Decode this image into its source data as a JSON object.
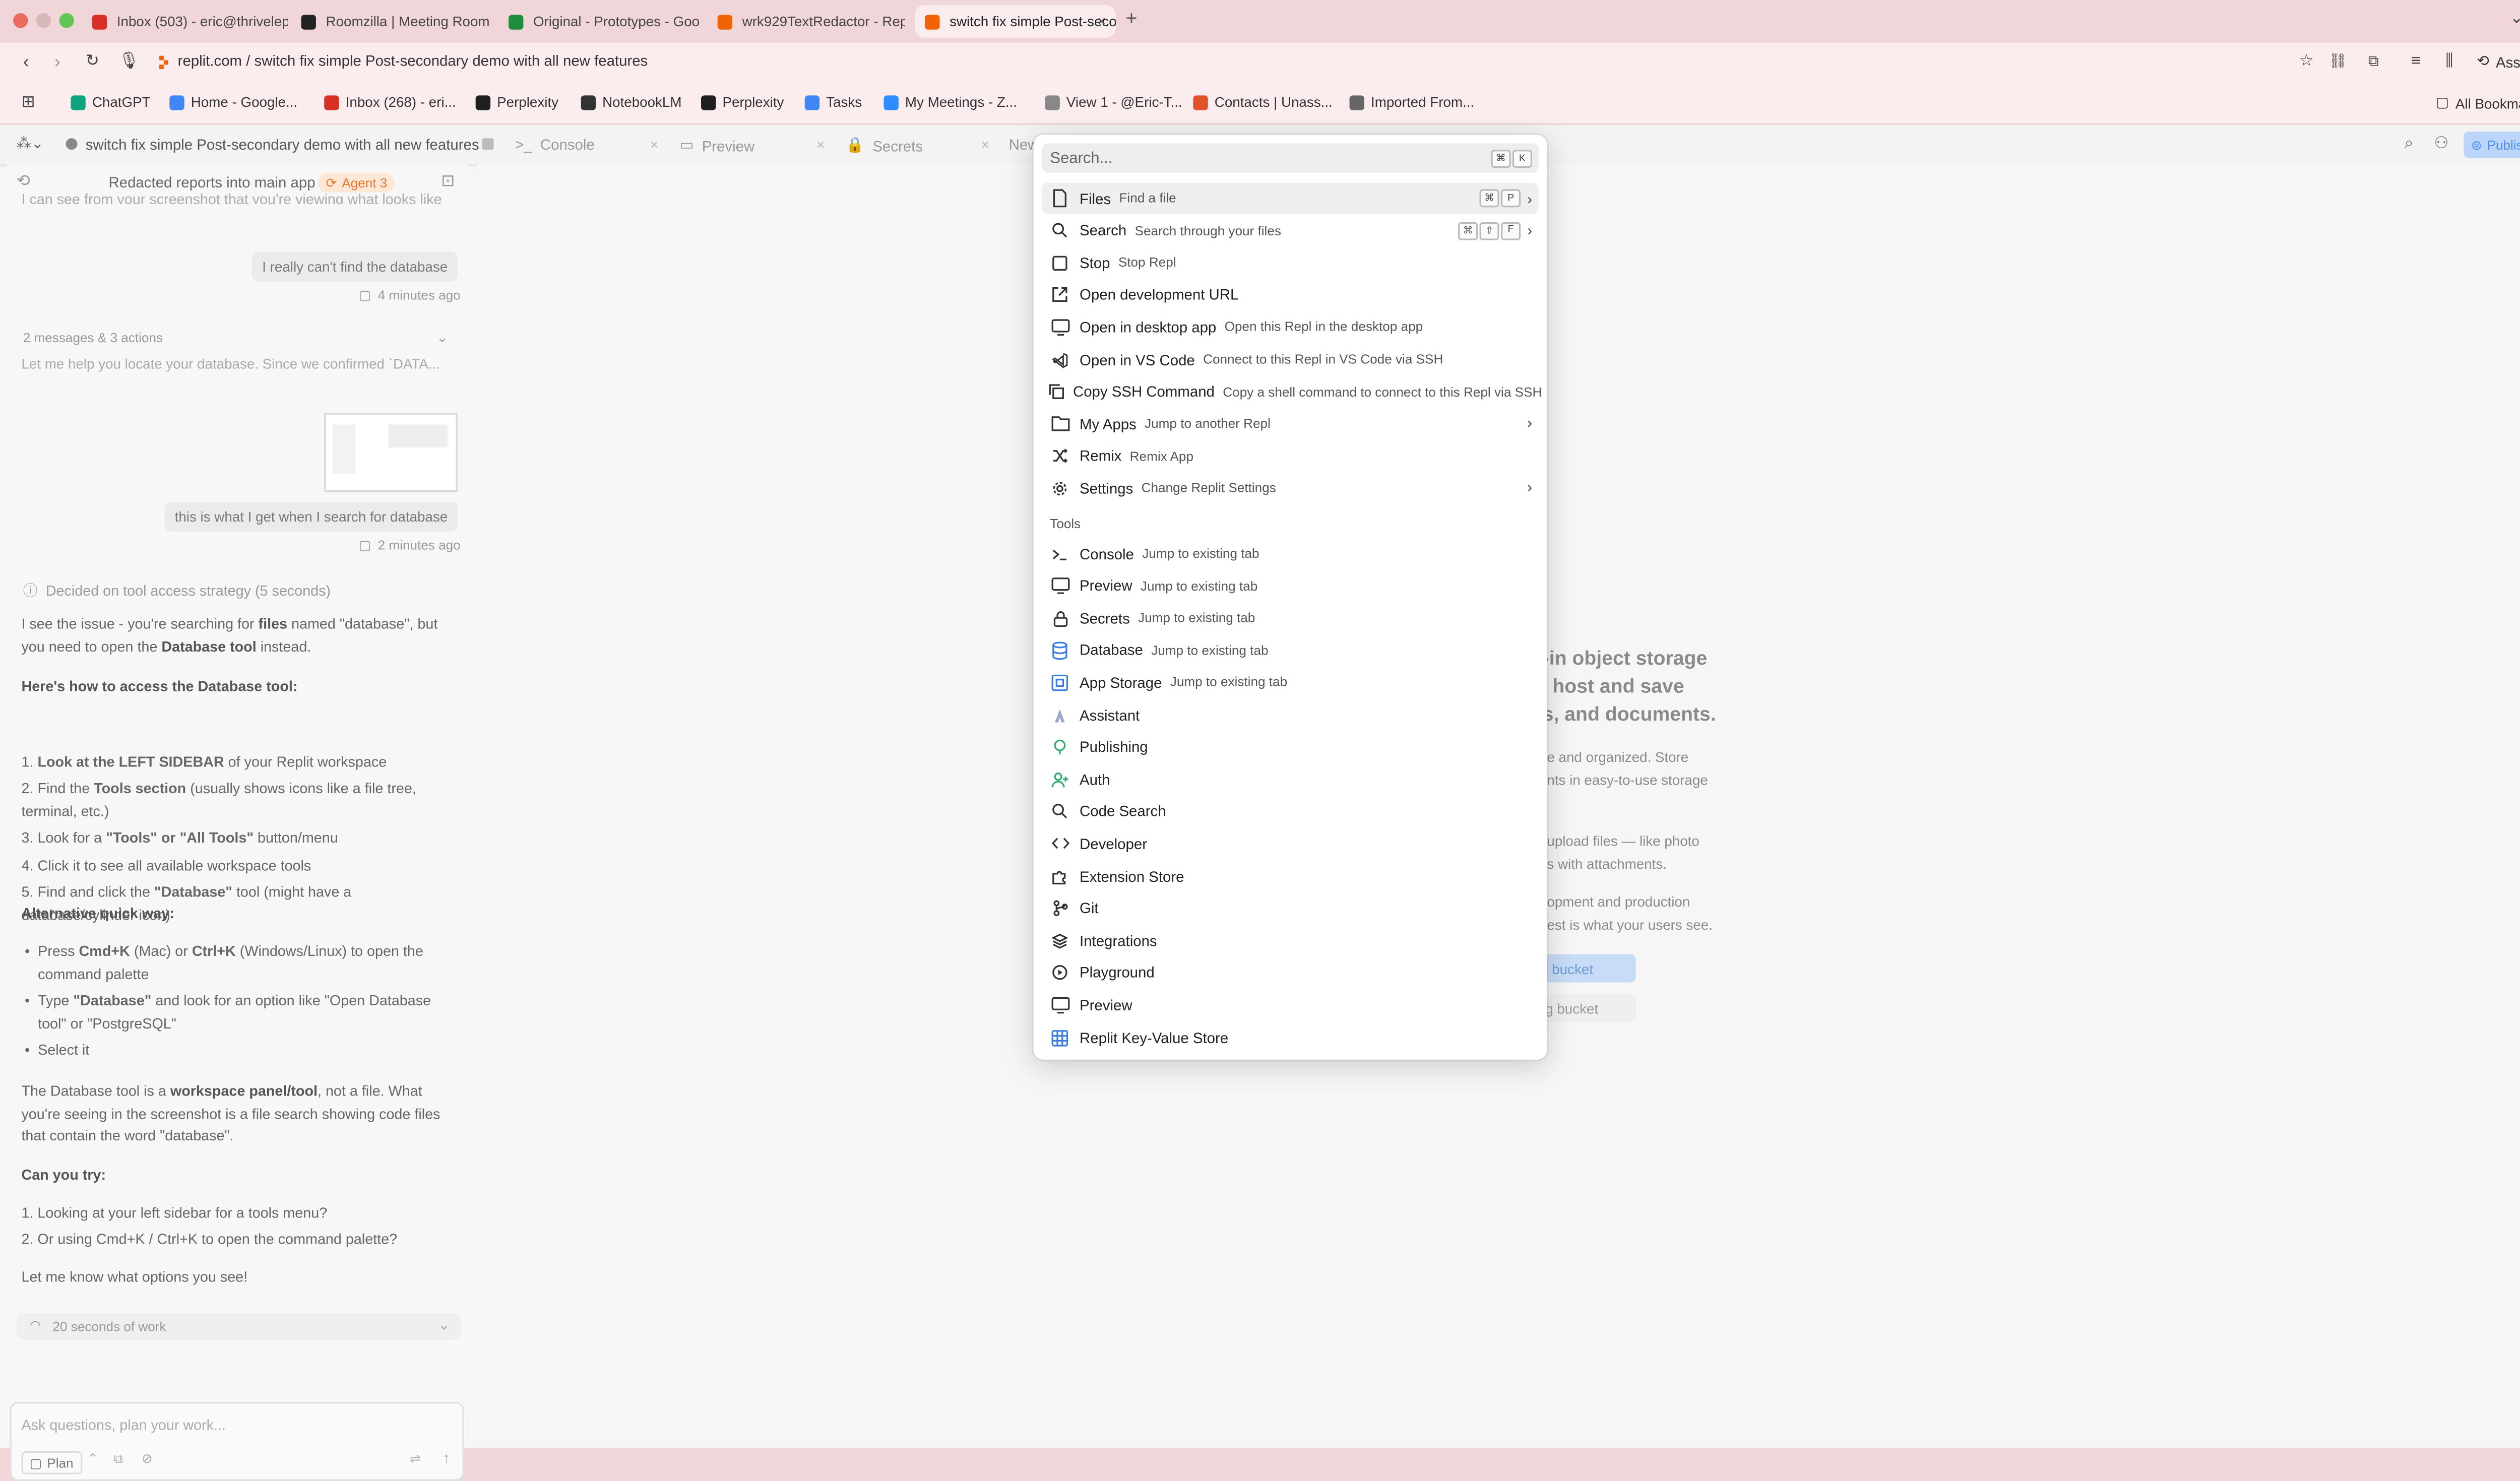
{
  "browser": {
    "tabs": [
      {
        "label": "Inbox (503) - eric@thrivelep",
        "icon": "gmail-icon",
        "color": "#d93025"
      },
      {
        "label": "Roomzilla | Meeting Room B",
        "icon": "roomzilla-icon",
        "color": "#222222"
      },
      {
        "label": "Original - Prototypes - Goo",
        "icon": "drive-icon",
        "color": "#1e8e3e"
      },
      {
        "label": "wrk929TextRedactor - Repl",
        "icon": "replit-icon",
        "color": "#f26207"
      },
      {
        "label": "switch fix simple Post-secon",
        "icon": "replit-icon",
        "color": "#f26207"
      }
    ],
    "address": "replit.com / switch fix simple Post-secondary demo with all new features",
    "assistant_label": "Assistant",
    "bookmarks": [
      "ChatGPT",
      "Home - Google...",
      "Inbox (268) - eri...",
      "Perplexity",
      "NotebookLM",
      "Perplexity",
      "Tasks",
      "My Meetings - Z...",
      "View 1 - @Eric-T...",
      "Contacts | Unass...",
      "Imported From..."
    ],
    "all_bookmarks": "All Bookmarks"
  },
  "workspace": {
    "title": "switch fix simple Post-secondary demo with all new features",
    "tabs": [
      "Console",
      "Preview",
      "Secrets",
      "New"
    ],
    "publish_label": "Publish"
  },
  "chat": {
    "header_title": "Redacted reports into main app",
    "agent_badge": "Agent 3",
    "top_fragment": "I can see from your screenshot that you're viewing what looks like",
    "msg1": "I really can't find the database",
    "msg1_time": "4 minutes ago",
    "collapsed_summary": "2 messages & 3 actions",
    "collapsed_preview": "Let me help you locate your database. Since we confirmed `DATA...",
    "msg2": "this is what I get when I search for database",
    "msg2_time": "2 minutes ago",
    "decided": "Decided on tool access strategy (5 seconds)",
    "intro_1": "I see the issue - you're searching for ",
    "intro_files": "files",
    "intro_2": " named \"database\", but you need to open the ",
    "intro_tool": "Database tool",
    "intro_3": " instead.",
    "howto_heading": "Here's how to access the Database tool:",
    "steps": [
      {
        "n": "1.",
        "b": "Look at the LEFT SIDEBAR",
        "t": " of your Replit workspace"
      },
      {
        "n": "2.",
        "pre": "Find the ",
        "b": "Tools section",
        "t": " (usually shows icons like a file tree, terminal, etc.)"
      },
      {
        "n": "3.",
        "pre": "Look for a ",
        "b": "\"Tools\" or \"All Tools\"",
        "t": " button/menu"
      },
      {
        "n": "4.",
        "pre": "Click it to see all available workspace tools",
        "b": "",
        "t": ""
      },
      {
        "n": "5.",
        "pre": "Find and click the ",
        "b": "\"Database\"",
        "t": " tool (might have a database/cylinder icon)"
      }
    ],
    "alt_heading": "Alternative quick way:",
    "alt_items": [
      {
        "pre": "Press ",
        "b1": "Cmd+K",
        "mid": " (Mac) or ",
        "b2": "Ctrl+K",
        "post": " (Windows/Linux) to open the command palette"
      },
      {
        "pre": "Type ",
        "b1": "\"Database\"",
        "mid": " and look for an option like \"Open Database tool\" or \"PostgreSQL\"",
        "b2": "",
        "post": ""
      },
      {
        "pre": "Select it",
        "b1": "",
        "mid": "",
        "b2": "",
        "post": ""
      }
    ],
    "explain_1": "The Database tool is a ",
    "explain_b": "workspace panel/tool",
    "explain_2": ", not a file. What you're seeing in the screenshot is a file search showing code files that contain the word \"database\".",
    "can_you": "Can you try:",
    "try_items": [
      "1. Looking at your left sidebar for a tools menu?",
      "2. Or using Cmd+K / Ctrl+K to open the command palette?"
    ],
    "closing": "Let me know what options you see!",
    "work_summary": "20 seconds of work",
    "input_placeholder": "Ask questions, plan your work...",
    "plan_label": "Plan"
  },
  "background_panel": {
    "line1": "lt-in object storage",
    "line2": "ly host and save",
    "line3": "ps, and documents.",
    "p1a": "e and organized. Store",
    "p1b": "nts in easy-to-use storage",
    "p2a": "upload files — like photo",
    "p2b": "s with attachments.",
    "p3a": "opment and production",
    "p3b": "est is what your users see.",
    "btn1": "bucket",
    "btn2": "g bucket"
  },
  "palette": {
    "search_placeholder": "Search...",
    "search_shortcut": [
      "⌘",
      "K"
    ],
    "items": [
      {
        "label": "Files",
        "desc": "Find a file",
        "icon": "file-icon",
        "keys": [
          "⌘",
          "P"
        ],
        "chevron": true
      },
      {
        "label": "Search",
        "desc": "Search through your files",
        "icon": "search-icon",
        "keys": [
          "⌘",
          "⇧",
          "F"
        ],
        "chevron": true
      },
      {
        "label": "Stop",
        "desc": "Stop Repl",
        "icon": "stop-icon",
        "keys": [],
        "chevron": false
      },
      {
        "label": "Open development URL",
        "desc": "",
        "icon": "external-link-icon",
        "keys": [],
        "chevron": false
      },
      {
        "label": "Open in desktop app",
        "desc": "Open this Repl in the desktop app",
        "icon": "monitor-icon",
        "keys": [],
        "chevron": false
      },
      {
        "label": "Open in VS Code",
        "desc": "Connect to this Repl in VS Code via SSH",
        "icon": "vscode-icon",
        "keys": [],
        "chevron": false
      },
      {
        "label": "Copy SSH Command",
        "desc": "Copy a shell command to connect to this Repl via SSH",
        "icon": "copy-icon",
        "keys": [],
        "chevron": false
      },
      {
        "label": "My Apps",
        "desc": "Jump to another Repl",
        "icon": "folder-icon",
        "keys": [],
        "chevron": true
      },
      {
        "label": "Remix",
        "desc": "Remix App",
        "icon": "shuffle-icon",
        "keys": [],
        "chevron": false
      },
      {
        "label": "Settings",
        "desc": "Change Replit Settings",
        "icon": "gear-icon",
        "keys": [],
        "chevron": true
      }
    ],
    "tools_header": "Tools",
    "tools": [
      {
        "label": "Console",
        "desc": "Jump to existing tab",
        "icon": "terminal-icon"
      },
      {
        "label": "Preview",
        "desc": "Jump to existing tab",
        "icon": "monitor-icon"
      },
      {
        "label": "Secrets",
        "desc": "Jump to existing tab",
        "icon": "lock-icon"
      },
      {
        "label": "Database",
        "desc": "Jump to existing tab",
        "icon": "database-icon"
      },
      {
        "label": "App Storage",
        "desc": "Jump to existing tab",
        "icon": "storage-icon"
      },
      {
        "label": "Assistant",
        "desc": "",
        "icon": "assistant-icon"
      },
      {
        "label": "Publishing",
        "desc": "",
        "icon": "publishing-icon"
      },
      {
        "label": "Auth",
        "desc": "",
        "icon": "user-plus-icon"
      },
      {
        "label": "Code Search",
        "desc": "",
        "icon": "search-icon"
      },
      {
        "label": "Developer",
        "desc": "",
        "icon": "code-icon"
      },
      {
        "label": "Extension Store",
        "desc": "",
        "icon": "puzzle-icon"
      },
      {
        "label": "Git",
        "desc": "",
        "icon": "git-icon"
      },
      {
        "label": "Integrations",
        "desc": "",
        "icon": "layers-icon"
      },
      {
        "label": "Playground",
        "desc": "",
        "icon": "play-circle-icon"
      },
      {
        "label": "Preview",
        "desc": "",
        "icon": "monitor-icon"
      },
      {
        "label": "Replit Key-Value Store",
        "desc": "",
        "icon": "table-icon"
      }
    ]
  }
}
